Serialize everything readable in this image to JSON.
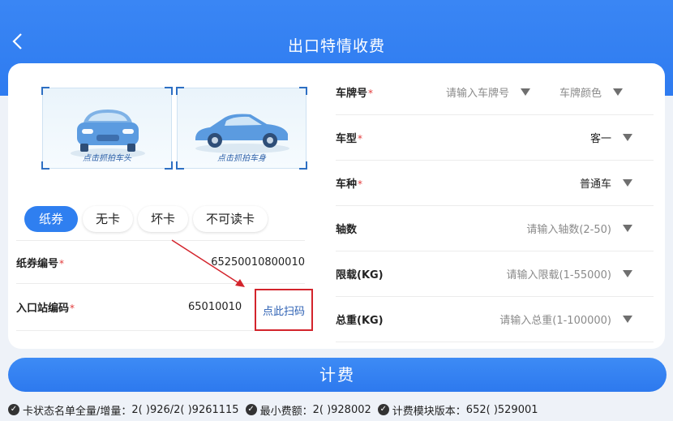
{
  "header": {
    "title": "出口特情收费"
  },
  "capture": {
    "front_caption": "点击抓拍车头",
    "side_caption": "点击抓拍车身"
  },
  "card_types": [
    "纸券",
    "无卡",
    "坏卡",
    "不可读卡"
  ],
  "left_fields": {
    "ticket_no": {
      "label": "纸券编号",
      "value": "65250010800010"
    },
    "entry_station": {
      "label": "入口站编码",
      "value": "65010010"
    }
  },
  "scan_button": "点此扫码",
  "right_fields": {
    "plate": {
      "label": "车牌号",
      "placeholder": "请输入车牌号",
      "color_placeholder": "车牌颜色"
    },
    "vehicle_type": {
      "label": "车型",
      "value": "客一"
    },
    "vehicle_class": {
      "label": "车种",
      "value": "普通车"
    },
    "axles": {
      "label": "轴数",
      "placeholder": "请输入轴数(2-50)"
    },
    "load_limit": {
      "label": "限载(KG)",
      "placeholder": "请输入限载(1-55000)"
    },
    "total_weight": {
      "label": "总重(KG)",
      "placeholder": "请输入总重(1-100000)"
    }
  },
  "fee_button": "计费",
  "status_bar": [
    {
      "label": "卡状态名单全量/增量：",
      "value": "2(    )926/2(    )9261115"
    },
    {
      "label": "最小费额：",
      "value": "2(       )928002"
    },
    {
      "label": "计费模块版本：",
      "value": "652(     )529001"
    }
  ],
  "colors": {
    "primary": "#2f7ff0",
    "highlight_box": "#d3242c",
    "required": "#e23b3b"
  }
}
